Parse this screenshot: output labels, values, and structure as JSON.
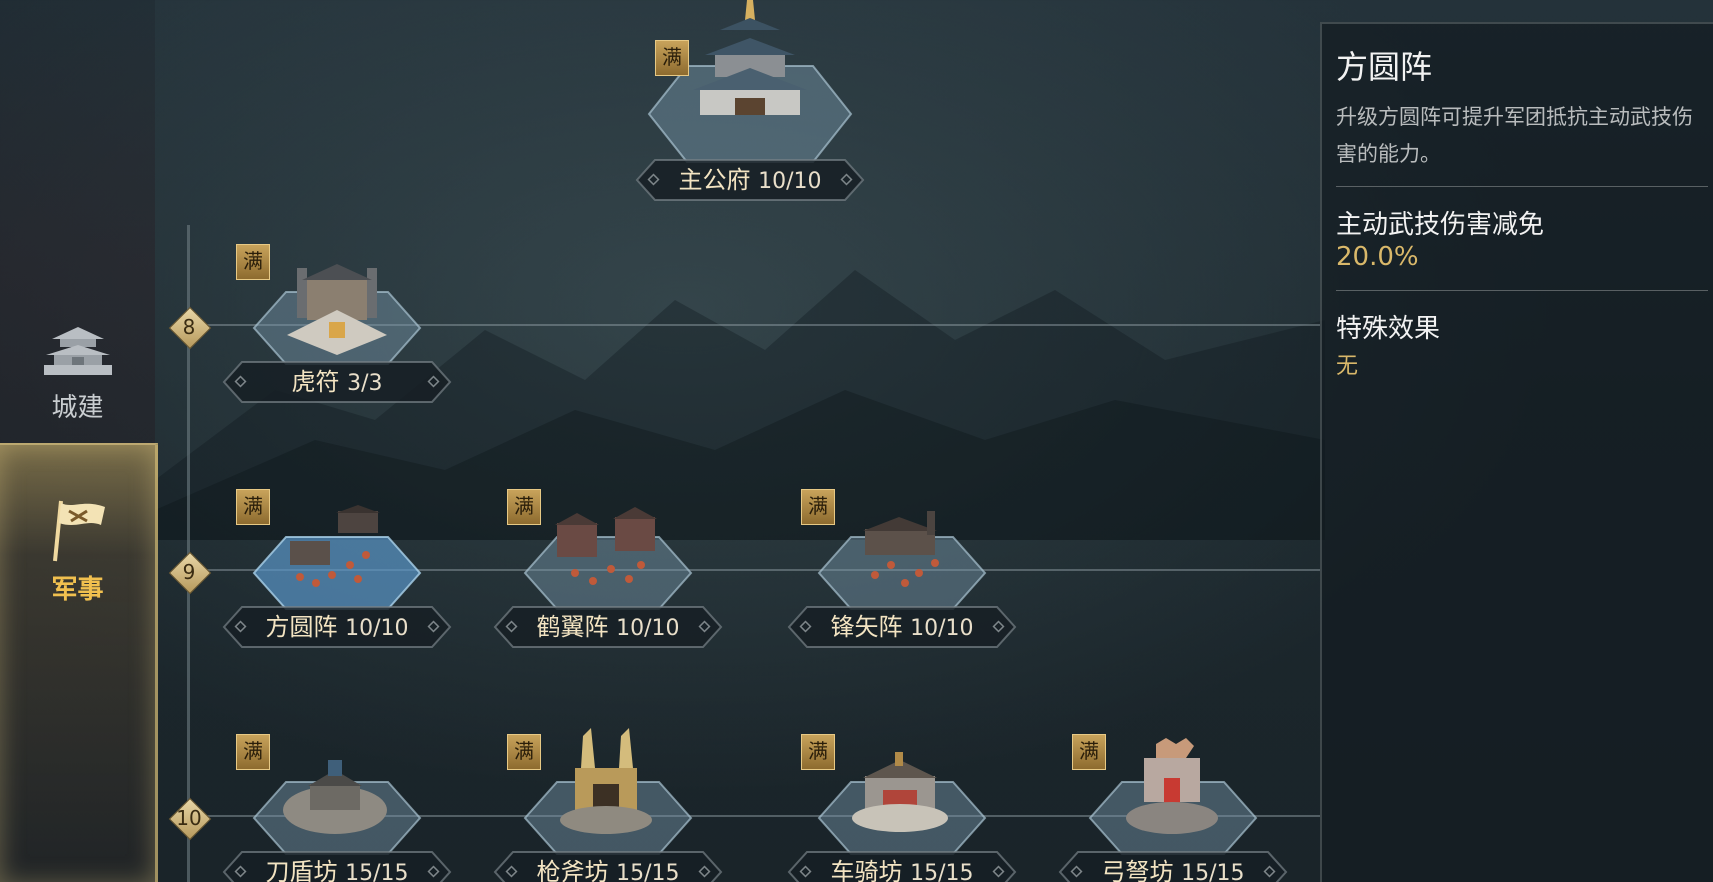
{
  "sidebar": {
    "tabs": [
      {
        "label": "城建",
        "icon": "pagoda-icon",
        "active": false
      },
      {
        "label": "军事",
        "icon": "war-flag-icon",
        "active": true
      }
    ]
  },
  "tree": {
    "top": {
      "name": "主公府",
      "level": "10/10",
      "badge": "满",
      "icon": "palace-icon"
    },
    "tiers": [
      {
        "num": "8",
        "nodes": [
          {
            "name": "虎符",
            "level": "3/3",
            "badge": "满",
            "icon": "tiger-tally-building-icon"
          }
        ]
      },
      {
        "num": "9",
        "nodes": [
          {
            "name": "方圆阵",
            "level": "10/10",
            "badge": "满",
            "icon": "square-formation-icon"
          },
          {
            "name": "鹤翼阵",
            "level": "10/10",
            "badge": "满",
            "icon": "crane-wing-formation-icon"
          },
          {
            "name": "锋矢阵",
            "level": "10/10",
            "badge": "满",
            "icon": "arrowhead-formation-icon"
          }
        ]
      },
      {
        "num": "10",
        "nodes": [
          {
            "name": "刀盾坊",
            "level": "15/15",
            "badge": "满",
            "icon": "blade-shield-workshop-icon"
          },
          {
            "name": "枪斧坊",
            "level": "15/15",
            "badge": "满",
            "icon": "spear-axe-workshop-icon"
          },
          {
            "name": "车骑坊",
            "level": "15/15",
            "badge": "满",
            "icon": "chariot-workshop-icon"
          },
          {
            "name": "弓弩坊",
            "level": "15/15",
            "badge": "满",
            "icon": "bow-workshop-icon"
          }
        ]
      }
    ]
  },
  "panel": {
    "title": "方圆阵",
    "description": "升级方圆阵可提升军团抵抗主动武技伤害的能力。",
    "stat_label": "主动武技伤害减免",
    "stat_value": "20.0%",
    "effect_label": "特殊效果",
    "effect_value": "无"
  },
  "colors": {
    "gold": "#d9b86a",
    "badge": "#b8934c",
    "active_tab": "#f1c04f"
  }
}
